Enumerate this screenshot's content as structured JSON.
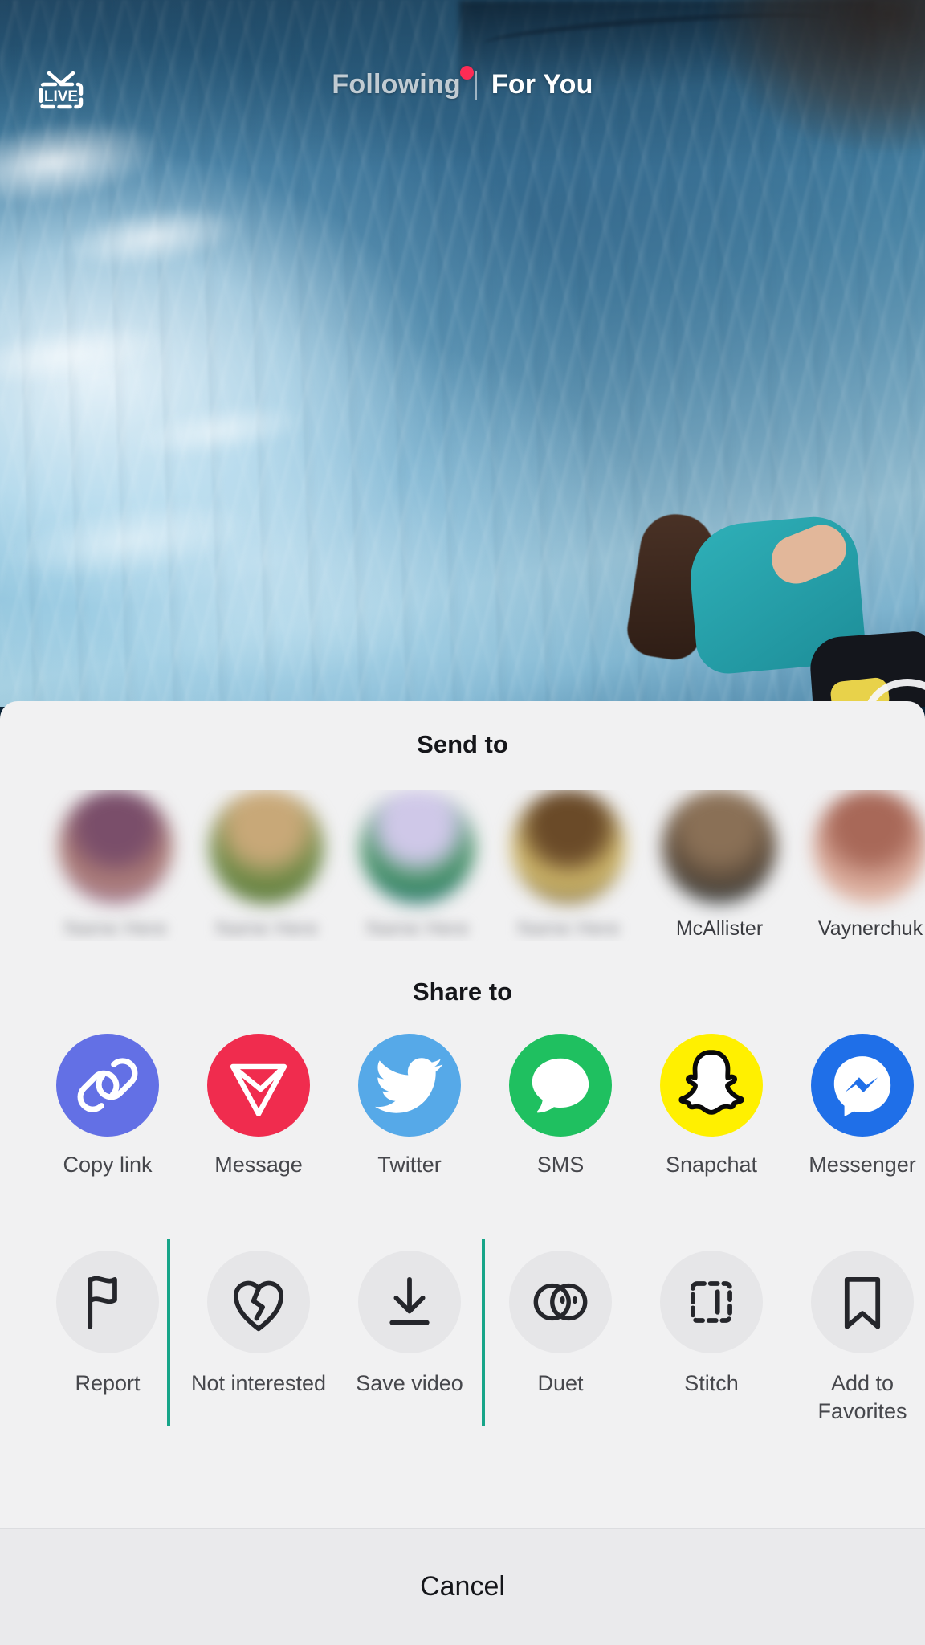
{
  "app": "TikTok",
  "topnav": {
    "live_label": "LIVE",
    "live_icon": "live-tv-icon",
    "tabs": [
      {
        "label": "Following",
        "active": false,
        "has_dot": true
      },
      {
        "label": "For You",
        "active": true,
        "has_dot": false
      }
    ],
    "separator": "|"
  },
  "sheet": {
    "send_to": {
      "title": "Send to",
      "contacts": [
        {
          "name": "",
          "name_blurred": true,
          "avatar_colors": [
            "#b08078",
            "#7a4e6a",
            "#8e6fa8"
          ]
        },
        {
          "name": "",
          "name_blurred": true,
          "avatar_colors": [
            "#6e8a46",
            "#c8a878",
            "#4f6a36"
          ]
        },
        {
          "name": "",
          "name_blurred": true,
          "avatar_colors": [
            "#3f8f5e",
            "#cfc8e8",
            "#2f6d9e"
          ]
        },
        {
          "name": "",
          "name_blurred": true,
          "avatar_colors": [
            "#d8c070",
            "#6a4a28",
            "#3a2a18"
          ]
        },
        {
          "name": "McAllister",
          "name_blurred": false,
          "avatar_colors": [
            "#5a4a3a",
            "#8a7056",
            "#2e4a5e"
          ]
        },
        {
          "name": "Vaynerchuk",
          "name_blurred": false,
          "avatar_colors": [
            "#d8a898",
            "#a86858",
            "#e8c8b8"
          ]
        }
      ]
    },
    "share_to": {
      "title": "Share to",
      "items": [
        {
          "label": "Copy link",
          "icon": "link-icon",
          "bg": "#6370e5",
          "fg": "#ffffff"
        },
        {
          "label": "Message",
          "icon": "send-plane-icon",
          "bg": "#f02c4e",
          "fg": "#ffffff"
        },
        {
          "label": "Twitter",
          "icon": "twitter-bird-icon",
          "bg": "#56a9e8",
          "fg": "#ffffff"
        },
        {
          "label": "SMS",
          "icon": "sms-bubble-icon",
          "bg": "#1fc060",
          "fg": "#ffffff"
        },
        {
          "label": "Snapchat",
          "icon": "snapchat-ghost-icon",
          "bg": "#fff000",
          "fg": "#ffffff"
        },
        {
          "label": "Messenger",
          "icon": "messenger-bolt-icon",
          "bg": "#1f6fe8",
          "fg": "#ffffff"
        }
      ]
    },
    "actions": [
      {
        "label": "Report",
        "icon": "flag-icon",
        "selected": false
      },
      {
        "label": "Not interested",
        "icon": "broken-heart-icon",
        "selected": true
      },
      {
        "label": "Save video",
        "icon": "download-arrow-icon",
        "selected": true
      },
      {
        "label": "Duet",
        "icon": "duet-circles-icon",
        "selected": false
      },
      {
        "label": "Stitch",
        "icon": "stitch-dashed-icon",
        "selected": false
      },
      {
        "label": "Add to Favorites",
        "icon": "bookmark-icon",
        "selected": false
      }
    ],
    "selection_highlight_color": "#17a589",
    "cancel_label": "Cancel"
  }
}
